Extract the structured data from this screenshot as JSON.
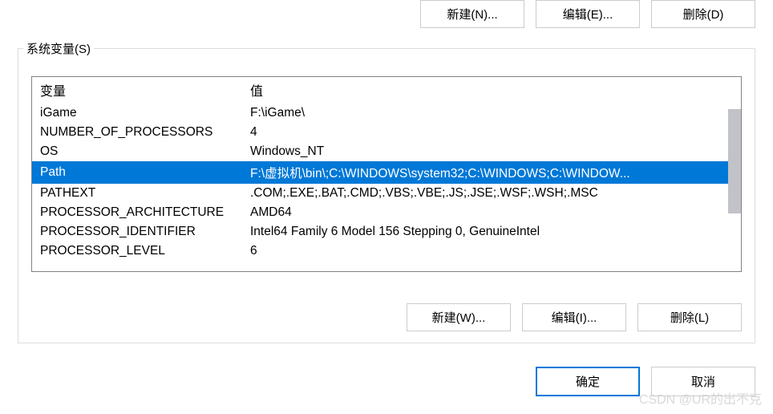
{
  "upper_buttons": {
    "new": "新建(N)...",
    "edit": "编辑(E)...",
    "delete": "删除(D)"
  },
  "group": {
    "title": "系统变量(S)",
    "columns": {
      "name": "变量",
      "value": "值"
    },
    "rows": [
      {
        "name": "iGame",
        "value": "F:\\iGame\\",
        "selected": false
      },
      {
        "name": "NUMBER_OF_PROCESSORS",
        "value": "4",
        "selected": false
      },
      {
        "name": "OS",
        "value": "Windows_NT",
        "selected": false
      },
      {
        "name": "Path",
        "value": "F:\\虚拟机\\bin\\;C:\\WINDOWS\\system32;C:\\WINDOWS;C:\\WINDOW...",
        "selected": true
      },
      {
        "name": "PATHEXT",
        "value": ".COM;.EXE;.BAT;.CMD;.VBS;.VBE;.JS;.JSE;.WSF;.WSH;.MSC",
        "selected": false
      },
      {
        "name": "PROCESSOR_ARCHITECTURE",
        "value": "AMD64",
        "selected": false
      },
      {
        "name": "PROCESSOR_IDENTIFIER",
        "value": "Intel64 Family 6 Model 156 Stepping 0, GenuineIntel",
        "selected": false
      },
      {
        "name": "PROCESSOR_LEVEL",
        "value": "6",
        "selected": false
      }
    ],
    "buttons": {
      "new": "新建(W)...",
      "edit": "编辑(I)...",
      "delete": "删除(L)"
    }
  },
  "dialog_buttons": {
    "ok": "确定",
    "cancel": "取消"
  },
  "watermark": "CSDN @UR的出不克"
}
